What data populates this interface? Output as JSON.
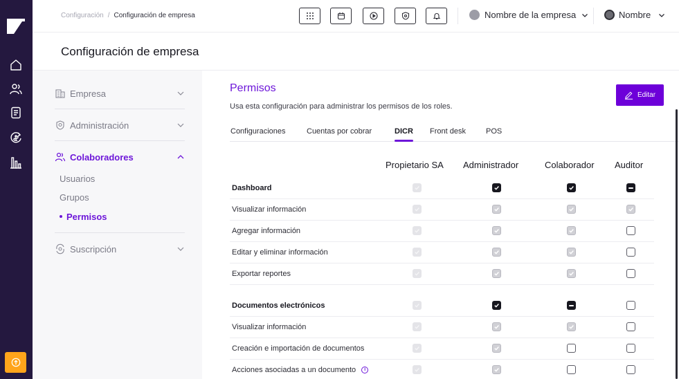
{
  "topbar": {
    "breadcrumb": [
      "Configuración",
      "Configuración de empresa"
    ],
    "breadcrumb_sep": "/",
    "icon_buttons": [
      "apps-grid-icon",
      "calendar-icon",
      "play-circle-icon",
      "shield-icon",
      "bell-icon"
    ],
    "company_name": "Nombre de la empresa",
    "user_name": "Nombre"
  },
  "page": {
    "title": "Configuración de empresa"
  },
  "sidebar": {
    "sections": [
      {
        "label": "Empresa",
        "icon": "building-icon",
        "expanded": false
      },
      {
        "label": "Administración",
        "icon": "admin-badge-icon",
        "expanded": false
      },
      {
        "label": "Colaboradores",
        "icon": "users-icon",
        "expanded": true,
        "items": [
          "Usuarios",
          "Grupos",
          "Permisos"
        ],
        "selected": "Permisos"
      },
      {
        "label": "Suscripción",
        "icon": "subscription-icon",
        "expanded": false
      }
    ]
  },
  "main": {
    "title": "Permisos",
    "description": "Usa esta configuración para administrar los permisos de los roles.",
    "edit_label": "Editar",
    "tabs": [
      "Configuraciones",
      "Cuentas por cobrar",
      "DICR",
      "Front desk",
      "POS"
    ],
    "active_tab": "DICR",
    "columns": [
      "Propietario SA",
      "Administrador",
      "Colaborador",
      "Auditor"
    ],
    "rows": [
      {
        "label": "Dashboard",
        "group": true,
        "states": [
          "disabled",
          "dark",
          "dark",
          "indet"
        ]
      },
      {
        "label": "Visualizar información",
        "states": [
          "disabled",
          "checked",
          "checked",
          "checked"
        ]
      },
      {
        "label": "Agregar información",
        "states": [
          "disabled",
          "checked",
          "checked",
          "empty"
        ]
      },
      {
        "label": "Editar y eliminar información",
        "states": [
          "disabled",
          "checked",
          "checked",
          "empty"
        ]
      },
      {
        "label": "Exportar reportes",
        "states": [
          "disabled",
          "checked",
          "checked",
          "empty"
        ]
      },
      {
        "label": "Documentos electrónicos",
        "group": true,
        "states": [
          "disabled",
          "dark",
          "indet",
          "empty"
        ]
      },
      {
        "label": "Visualizar información",
        "states": [
          "disabled",
          "checked",
          "checked",
          "empty"
        ]
      },
      {
        "label": "Creación e importación de documentos",
        "states": [
          "disabled",
          "checked",
          "empty",
          "empty"
        ]
      },
      {
        "label": "Acciones asociadas a un documento",
        "info": true,
        "states": [
          "disabled",
          "checked",
          "empty",
          "empty"
        ]
      }
    ]
  },
  "colors": {
    "accent": "#6d16d9",
    "rail": "#24183f",
    "help": "#ffa41b"
  }
}
